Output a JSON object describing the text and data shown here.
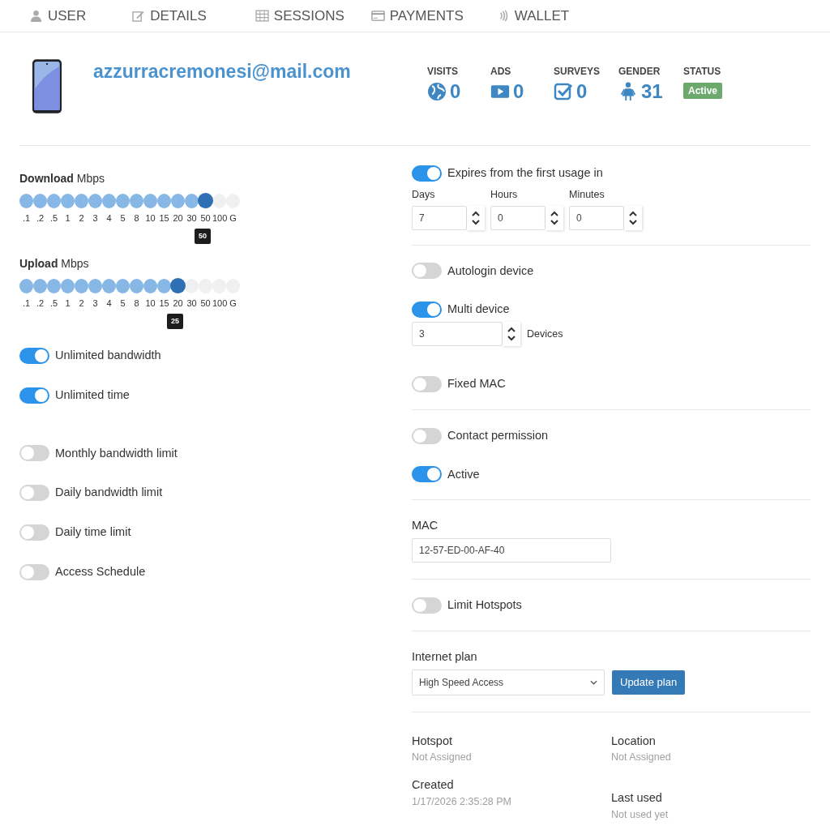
{
  "tabs": [
    {
      "label": "USER"
    },
    {
      "label": "DETAILS"
    },
    {
      "label": "SESSIONS"
    },
    {
      "label": "PAYMENTS"
    },
    {
      "label": "WALLET"
    }
  ],
  "profile": {
    "email": "azzurracremonesi@mail.com",
    "stats": [
      {
        "label": "VISITS",
        "value": "0"
      },
      {
        "label": "ADS",
        "value": "0"
      },
      {
        "label": "SURVEYS",
        "value": "0"
      },
      {
        "label": "GENDER",
        "value": "31"
      }
    ],
    "status": {
      "label": "STATUS",
      "badge": "Active"
    }
  },
  "speed_limits": [
    {
      "title": "**Download** Mbps",
      "ticks": [
        ".1",
        ".2",
        ".5",
        "1",
        "2",
        "3",
        "4",
        "5",
        "8",
        "10",
        "15",
        "20",
        "30",
        "50",
        "100",
        "G"
      ],
      "level": 0.867,
      "tooltip": "50"
    },
    {
      "title": "**Upload** Mbps",
      "ticks": [
        ".1",
        ".2",
        ".5",
        "1",
        "2",
        "3",
        "4",
        "5",
        "8",
        "10",
        "15",
        "20",
        "30",
        "50",
        "100",
        "G"
      ],
      "level": 0.733,
      "tooltip": "25"
    }
  ],
  "left_toggle_groups": [
    [
      {
        "label": "Unlimited bandwidth",
        "on": true
      },
      {
        "label": "Unlimited time",
        "on": true
      }
    ],
    [
      {
        "label": "Monthly bandwidth limit",
        "on": false
      },
      {
        "label": "Daily bandwidth limit",
        "on": false
      },
      {
        "label": "Daily time limit",
        "on": false
      },
      {
        "label": "Access Schedule",
        "on": false
      }
    ]
  ],
  "right_sections": [
    [
      {
        "kind": "switch",
        "label": "Expires from the first usage in",
        "on": true
      },
      {
        "kind": "durations",
        "fields": [
          {
            "label": "Days",
            "value": "7"
          },
          {
            "label": "Hours",
            "value": "0"
          },
          {
            "label": "Minutes",
            "value": "0"
          }
        ]
      }
    ],
    [
      {
        "kind": "switch",
        "label": "Autologin device",
        "on": false
      },
      {
        "kind": "switch",
        "label": "Multi device",
        "on": true
      },
      {
        "kind": "count",
        "value": "3",
        "unit": "Devices"
      },
      {
        "kind": "switch",
        "label": "Fixed MAC",
        "on": false
      }
    ],
    [
      {
        "kind": "switch",
        "label": "Contact permission",
        "on": false
      },
      {
        "kind": "switch",
        "label": "Active",
        "on": true
      }
    ],
    [
      {
        "kind": "text",
        "label": "MAC",
        "value": "12-57-ED-00-AF-40"
      }
    ],
    [
      {
        "kind": "switch",
        "label": "Limit Hotspots",
        "on": false
      }
    ],
    [
      {
        "kind": "plan",
        "label": "Internet plan",
        "value": "High Speed Access",
        "button": "Update plan"
      }
    ],
    [
      {
        "kind": "info",
        "columns": [
          [
            {
              "label": "Hotspot",
              "value": "Not Assigned"
            },
            {
              "label": "Created",
              "value": "1/17/2026 2:35:28 PM"
            }
          ],
          [
            {
              "label": "Location",
              "value": "Not Assigned"
            },
            {
              "label": "Last used",
              "value": "Not used yet"
            }
          ]
        ]
      }
    ]
  ]
}
